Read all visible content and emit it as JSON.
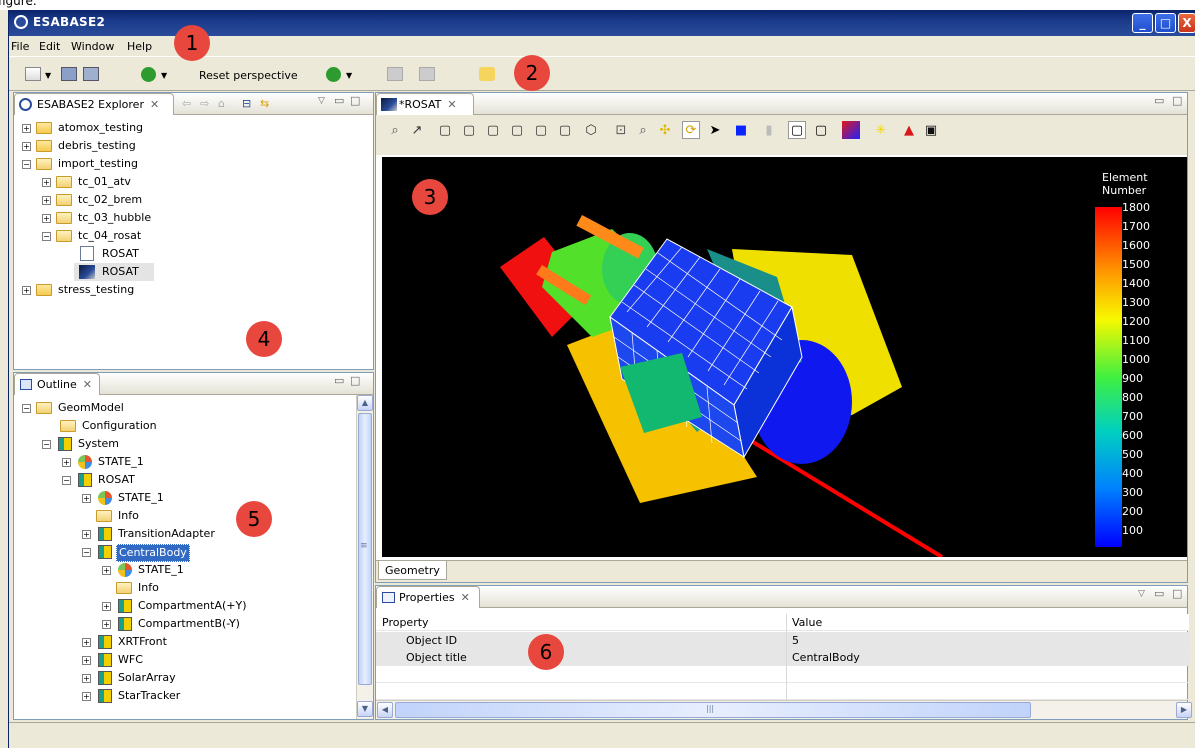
{
  "app": {
    "title": "ESABASE2"
  },
  "top_strip_text": "figure.",
  "window_buttons": {
    "minimize": "_",
    "maximize": "□",
    "close": "X"
  },
  "menu": [
    "File",
    "Edit",
    "Window",
    "Help"
  ],
  "toolbar": {
    "reset_perspective": "Reset perspective"
  },
  "badges": [
    "1",
    "2",
    "3",
    "4",
    "5",
    "6"
  ],
  "explorer": {
    "tab_label": "ESABASE2 Explorer",
    "items": [
      {
        "label": "atomox_testing"
      },
      {
        "label": "debris_testing"
      },
      {
        "label": "import_testing"
      },
      {
        "label": "tc_01_atv"
      },
      {
        "label": "tc_02_brem"
      },
      {
        "label": "tc_03_hubble"
      },
      {
        "label": "tc_04_rosat"
      },
      {
        "label": "ROSAT"
      },
      {
        "label": "ROSAT"
      },
      {
        "label": "stress_testing"
      }
    ]
  },
  "outline": {
    "tab_label": "Outline",
    "items": [
      {
        "label": "GeomModel"
      },
      {
        "label": "Configuration"
      },
      {
        "label": "System"
      },
      {
        "label": "STATE_1"
      },
      {
        "label": "ROSAT"
      },
      {
        "label": "STATE_1"
      },
      {
        "label": "Info"
      },
      {
        "label": "TransitionAdapter"
      },
      {
        "label": "CentralBody"
      },
      {
        "label": "STATE_1"
      },
      {
        "label": "Info"
      },
      {
        "label": "CompartmentA(+Y)"
      },
      {
        "label": "CompartmentB(-Y)"
      },
      {
        "label": "XRTFront"
      },
      {
        "label": "WFC"
      },
      {
        "label": "SolarArray"
      },
      {
        "label": "StarTracker"
      }
    ]
  },
  "editor": {
    "tab_label": "*ROSAT",
    "bottom_tab": "Geometry",
    "legend_title": "Element Number",
    "legend_ticks": [
      "1800",
      "1700",
      "1600",
      "1500",
      "1400",
      "1300",
      "1200",
      "1100",
      "1000",
      "900",
      "800",
      "700",
      "600",
      "500",
      "400",
      "300",
      "200",
      "100"
    ],
    "colors": {
      "background": "#000000",
      "beam": "#ff0000"
    }
  },
  "properties": {
    "tab_label": "Properties",
    "headers": [
      "Property",
      "Value"
    ],
    "rows": [
      {
        "property": "Object ID",
        "value": "5"
      },
      {
        "property": "Object title",
        "value": "CentralBody"
      }
    ]
  },
  "scroll_arrows": {
    "up": "▲",
    "down": "▼",
    "left": "◀",
    "right": "▶",
    "grip": "≡",
    "grip_h": "|||"
  }
}
